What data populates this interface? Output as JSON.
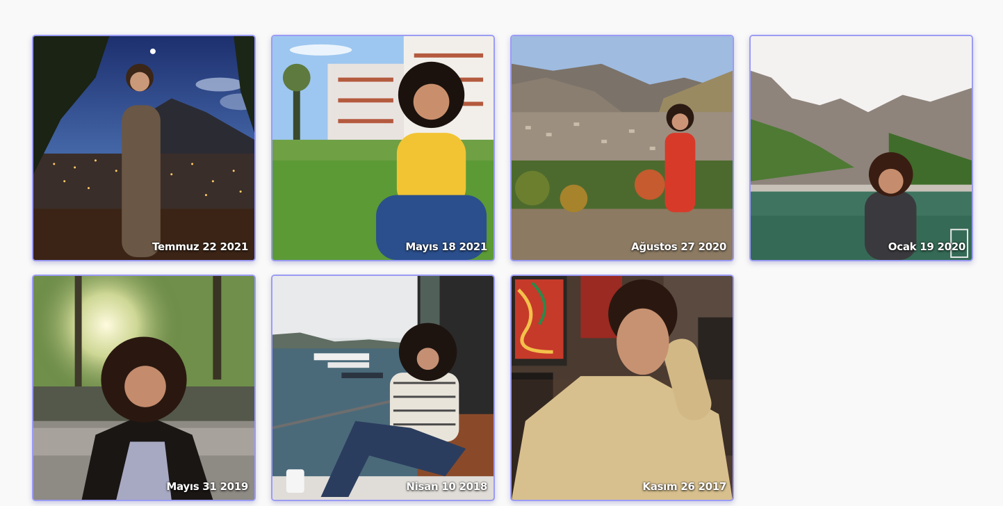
{
  "photos": [
    {
      "date": "Temmuz 22 2021",
      "scene": "night-city-view"
    },
    {
      "date": "Mayıs 18 2021",
      "scene": "garden-apartments"
    },
    {
      "date": "Ağustos 27 2020",
      "scene": "mountain-town"
    },
    {
      "date": "Ocak 19 2020",
      "scene": "lake-canyon"
    },
    {
      "date": "Mayıs 31 2019",
      "scene": "forest-sunlight"
    },
    {
      "date": "Nisan 10 2018",
      "scene": "bosphorus-balcony"
    },
    {
      "date": "Kasım 26 2017",
      "scene": "cafe-portrait"
    }
  ],
  "colors": {
    "page_background": "#f9f9f9",
    "card_border": "#9b9bf5",
    "caption_text": "#ffffff"
  }
}
